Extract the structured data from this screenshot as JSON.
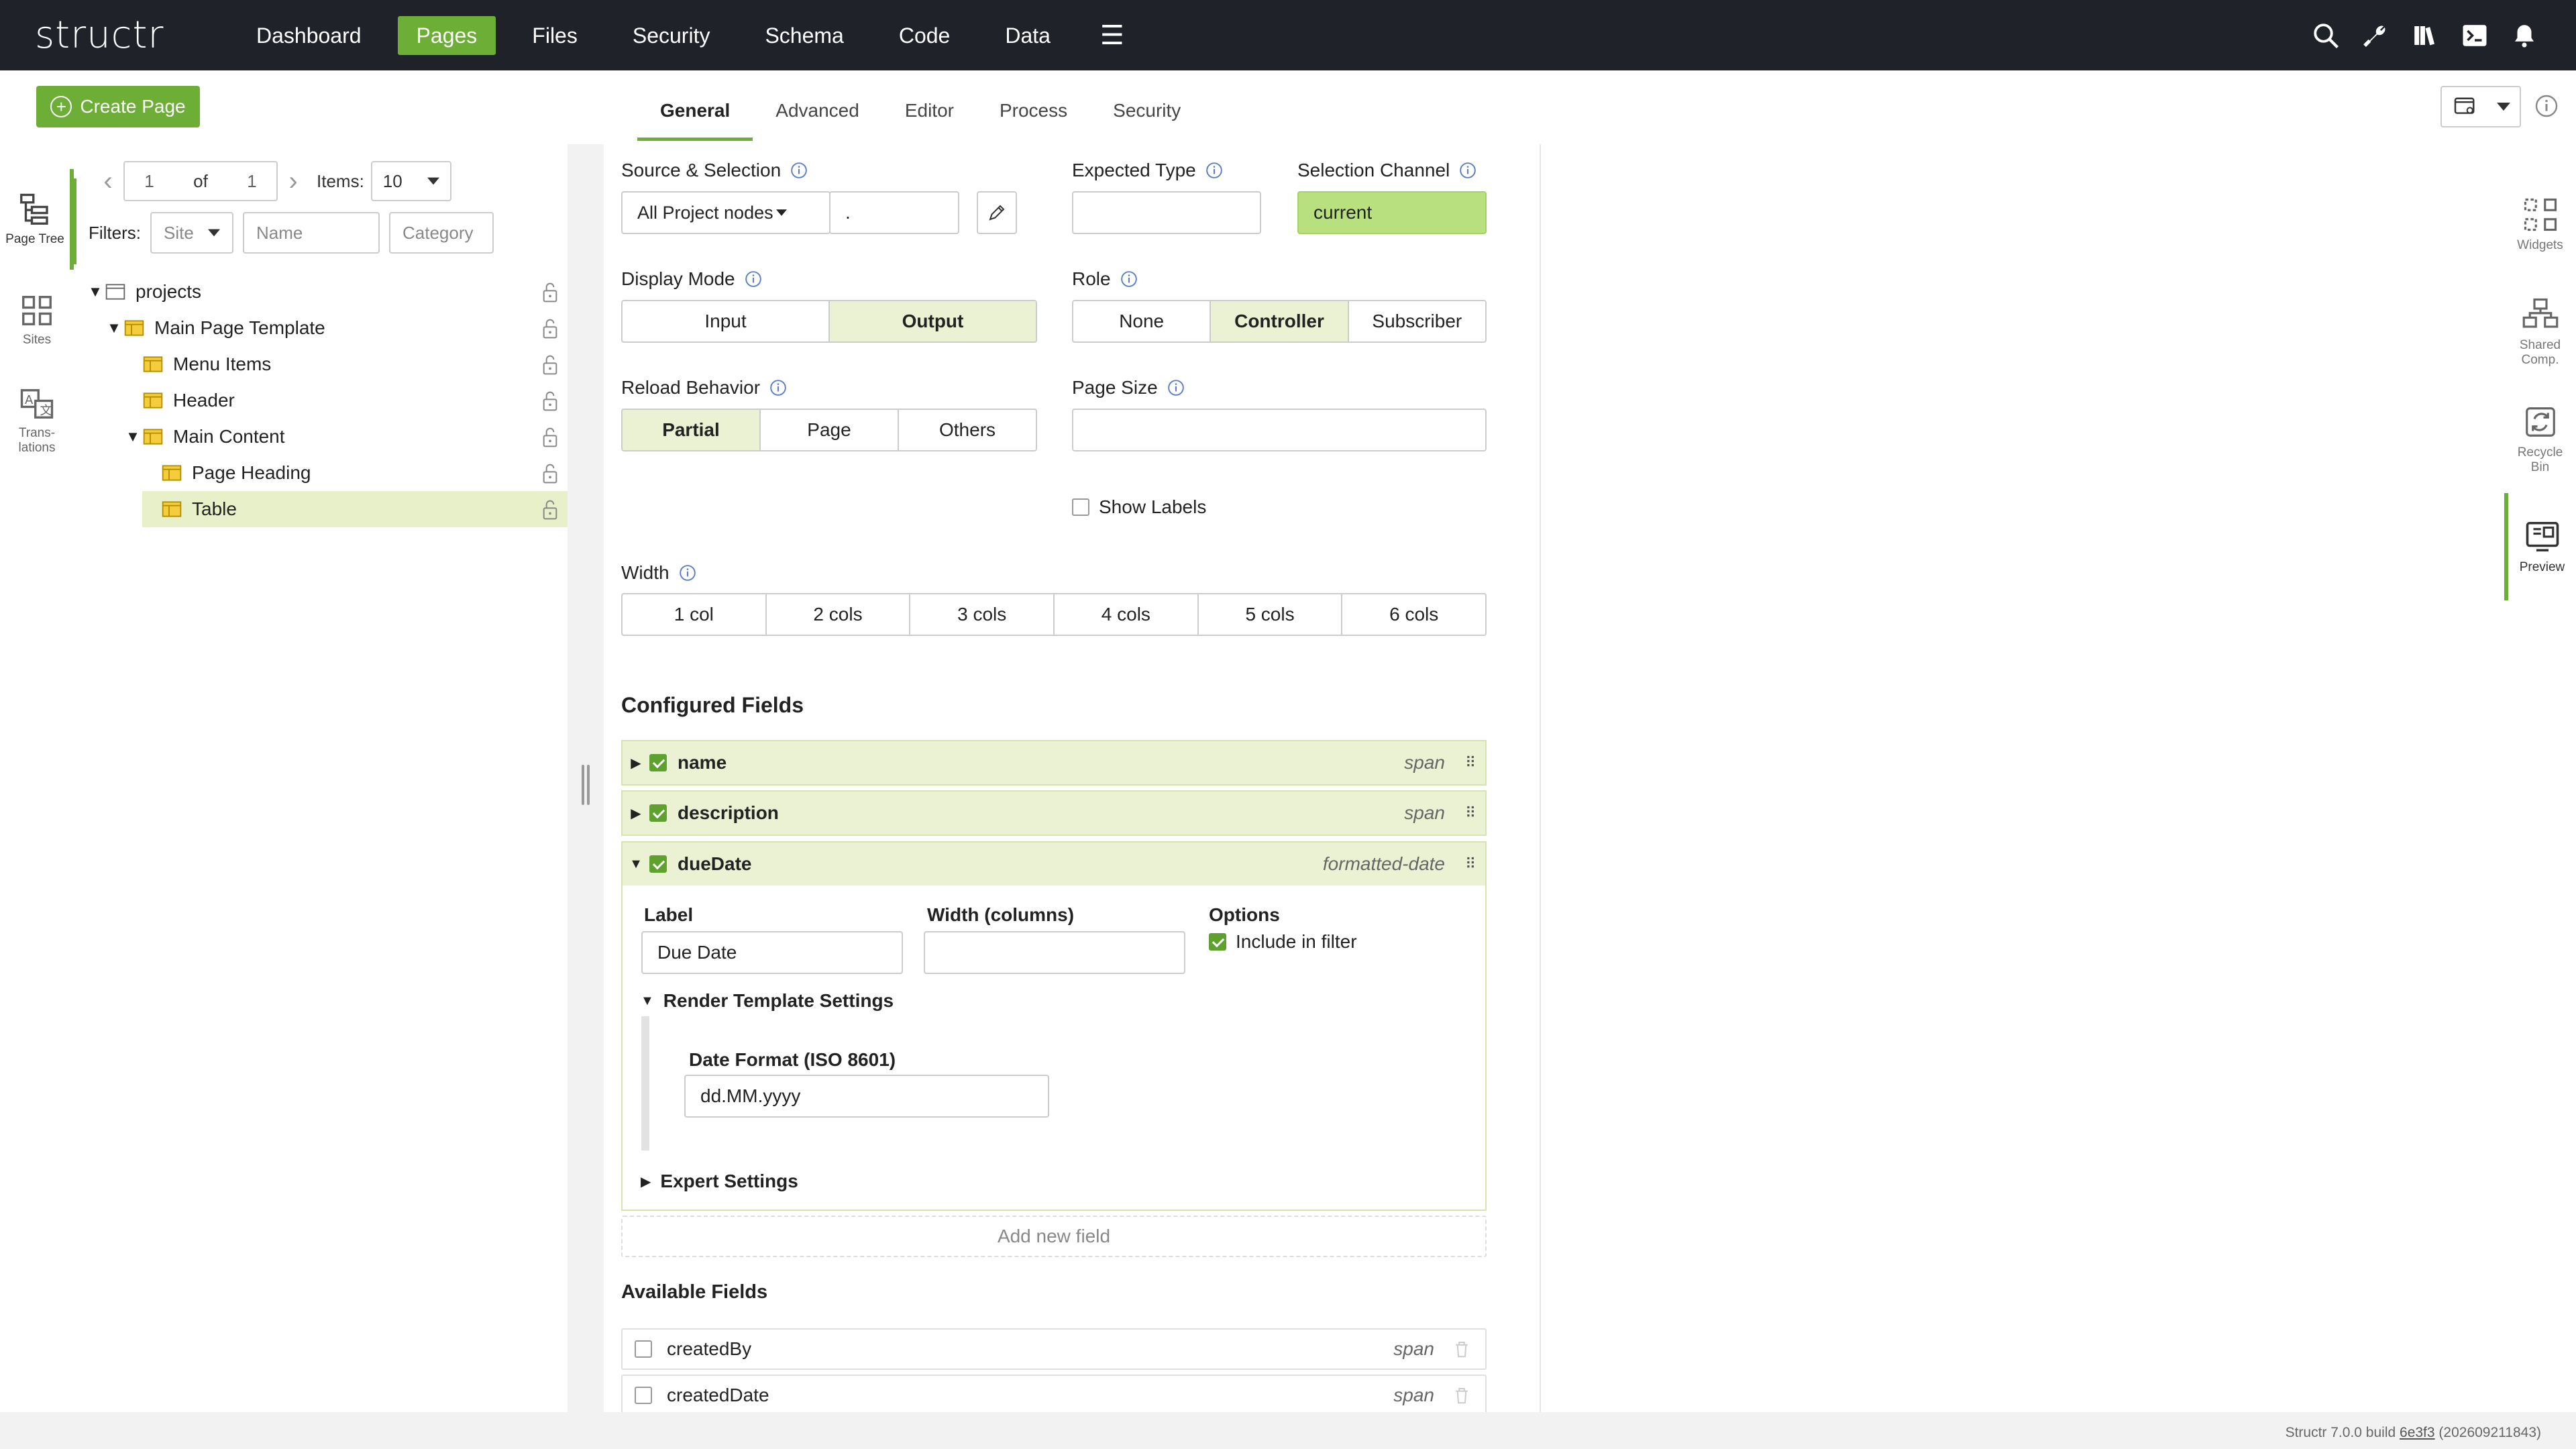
{
  "app": {
    "logo": "structr",
    "nav": [
      "Dashboard",
      "Pages",
      "Files",
      "Security",
      "Schema",
      "Code",
      "Data"
    ],
    "nav_active": "Pages",
    "hamburger": "☰"
  },
  "toolbar": {
    "create_page": "Create Page",
    "tabs": [
      "General",
      "Advanced",
      "Editor",
      "Process",
      "Security"
    ],
    "active_tab": "General"
  },
  "left_rail": [
    {
      "label": "Page Tree",
      "icon": "page-tree-icon"
    },
    {
      "label": "Sites",
      "icon": "sites-icon"
    },
    {
      "label": "Trans- lations",
      "icon": "translations-icon"
    }
  ],
  "pager": {
    "page": "1",
    "of_label": "of",
    "total": "1",
    "items_label": "Items:",
    "items_value": "10"
  },
  "filters": {
    "label": "Filters:",
    "site": "Site",
    "name_placeholder": "Name",
    "category_placeholder": "Category"
  },
  "tree": [
    {
      "label": "projects",
      "level": 0
    },
    {
      "label": "Main Page Template",
      "level": 1
    },
    {
      "label": "Menu Items",
      "level": 2
    },
    {
      "label": "Header",
      "level": 2
    },
    {
      "label": "Main Content",
      "level": 2
    },
    {
      "label": "Page Heading",
      "level": 3
    },
    {
      "label": "Table",
      "level": 3,
      "selected": true
    }
  ],
  "config": {
    "source_label": "Source & Selection",
    "source_value": "All Project nodes",
    "source_dot": ".",
    "expected_type_label": "Expected Type",
    "selection_channel_label": "Selection Channel",
    "selection_channel_value": "current",
    "display_mode_label": "Display Mode",
    "display_mode_options": [
      "Input",
      "Output"
    ],
    "display_mode_selected": "Output",
    "role_label": "Role",
    "role_options": [
      "None",
      "Controller",
      "Subscriber"
    ],
    "role_selected": "Controller",
    "reload_label": "Reload Behavior",
    "reload_options": [
      "Partial",
      "Page",
      "Others"
    ],
    "reload_selected": "Partial",
    "page_size_label": "Page Size",
    "show_labels": "Show Labels",
    "width_label": "Width",
    "width_options": [
      "1 col",
      "2 cols",
      "3 cols",
      "4 cols",
      "5 cols",
      "6 cols"
    ],
    "configured_fields_title": "Configured Fields",
    "fields": [
      {
        "name": "name",
        "type": "span",
        "expanded": false
      },
      {
        "name": "description",
        "type": "span",
        "expanded": false
      },
      {
        "name": "dueDate",
        "type": "formatted-date",
        "expanded": true
      }
    ],
    "detail": {
      "label_label": "Label",
      "label_value": "Due Date",
      "width_cols_label": "Width (columns)",
      "options_label": "Options",
      "include_filter": "Include in filter",
      "render_settings": "Render Template Settings",
      "date_format_label": "Date Format (ISO 8601)",
      "date_format_value": "dd.MM.yyyy",
      "expert_settings": "Expert Settings"
    },
    "add_new_field": "Add new field",
    "available_fields_title": "Available Fields",
    "available_fields": [
      {
        "name": "createdBy",
        "type": "span"
      },
      {
        "name": "createdDate",
        "type": "span"
      }
    ]
  },
  "right_rail": [
    {
      "label": "Widgets",
      "icon": "widgets-icon"
    },
    {
      "label": "Shared Comp.",
      "icon": "shared-components-icon"
    },
    {
      "label": "Recycle Bin",
      "icon": "recycle-bin-icon"
    },
    {
      "label": "Preview",
      "icon": "preview-icon",
      "active": true
    }
  ],
  "footer": {
    "prefix": "Structr 7.0.0 build",
    "build": "6e3f3",
    "date": "(202609211843)"
  }
}
